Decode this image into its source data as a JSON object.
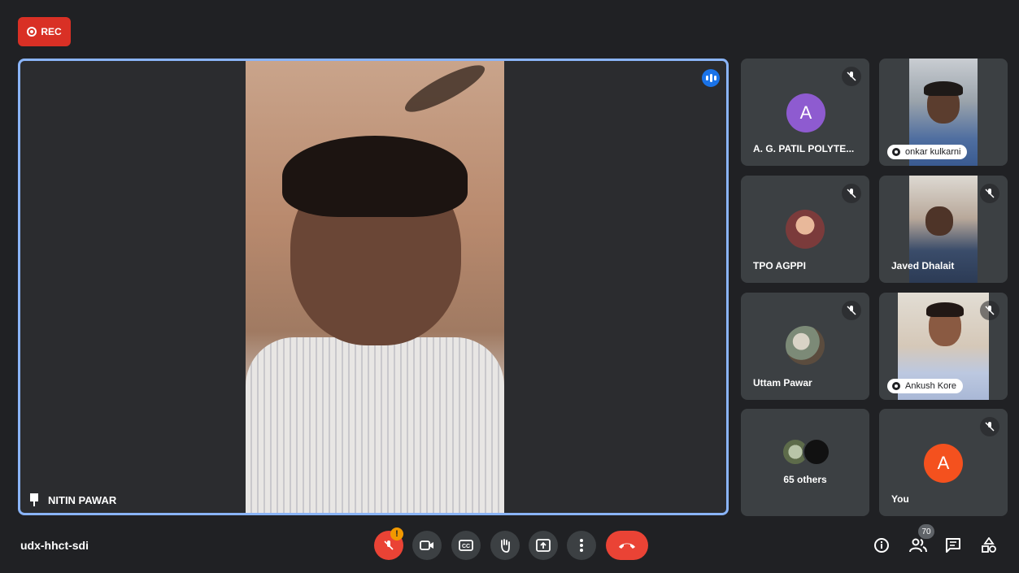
{
  "recording": {
    "label": "REC",
    "color": "#d93025"
  },
  "main_speaker": {
    "name": "NITIN PAWAR",
    "border_color": "#8ab4f8"
  },
  "tiles": [
    {
      "name": "A. G. PATIL POLYTE...",
      "initial": "A",
      "avatar_color": "#8e5bd0",
      "muted": true
    },
    {
      "name": "onkar kulkarni",
      "muted": false
    },
    {
      "name": "TPO AGPPI",
      "muted": true
    },
    {
      "name": "Javed Dhalait",
      "muted": true
    },
    {
      "name": "Uttam Pawar",
      "muted": true
    },
    {
      "name": "Ankush Kore",
      "muted": true
    },
    {
      "name": "65 others"
    },
    {
      "name": "You",
      "initial": "A",
      "avatar_color": "#f4511e",
      "muted": true
    }
  ],
  "meeting_code": "udx-hhct-sdi",
  "controls": {
    "mic_warning": "!",
    "people_count": "70"
  },
  "icons": [
    "mic-off-icon",
    "camera-icon",
    "captions-icon",
    "raise-hand-icon",
    "present-icon",
    "more-icon",
    "hang-up-icon",
    "info-icon",
    "people-icon",
    "chat-icon",
    "activities-icon"
  ]
}
